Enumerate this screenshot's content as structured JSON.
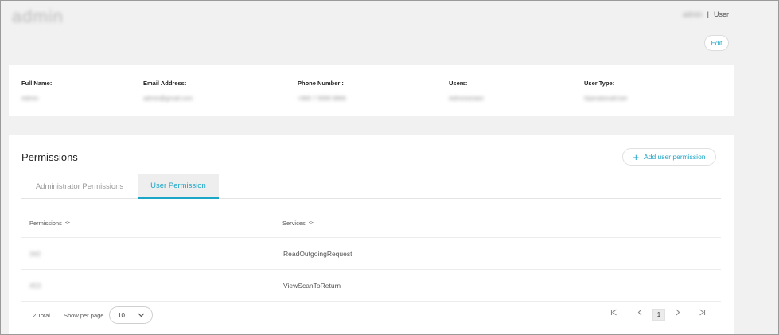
{
  "header": {
    "logo": "admin",
    "breadcrumb": {
      "masked_user": "admin",
      "separator": "|",
      "current": "User"
    },
    "edit_label": "Edit"
  },
  "info": {
    "fields": [
      {
        "label": "Full Name:",
        "value": "Admin"
      },
      {
        "label": "Email Address:",
        "value": "admin@gmail.com"
      },
      {
        "label": "Phone Number :",
        "value": "+966 7 9999 9866"
      },
      {
        "label": "Users:",
        "value": "Administrator"
      },
      {
        "label": "User Type:",
        "value": "OperationalUser"
      }
    ]
  },
  "permissions": {
    "title": "Permissions",
    "add_label": "Add user permission",
    "tabs": [
      {
        "label": "Administrator Permissions",
        "active": false
      },
      {
        "label": "User Permission",
        "active": true
      }
    ],
    "columns": [
      "Permissions",
      "Services"
    ],
    "rows": [
      {
        "permission": "342",
        "service": "ReadOutgoingRequest"
      },
      {
        "permission": "453",
        "service": "ViewScanToReturn"
      }
    ],
    "footer": {
      "total": "2 Total",
      "show_per_page": "Show per page",
      "per_page_value": "10",
      "current_page": "1"
    }
  },
  "colors": {
    "accent": "#1aa6c7",
    "background": "#f1f1f1",
    "card": "#ffffff"
  },
  "icons": [
    "plus-icon",
    "sort-icon",
    "chevron-down-icon",
    "first-page-icon",
    "prev-page-icon",
    "next-page-icon",
    "last-page-icon"
  ]
}
